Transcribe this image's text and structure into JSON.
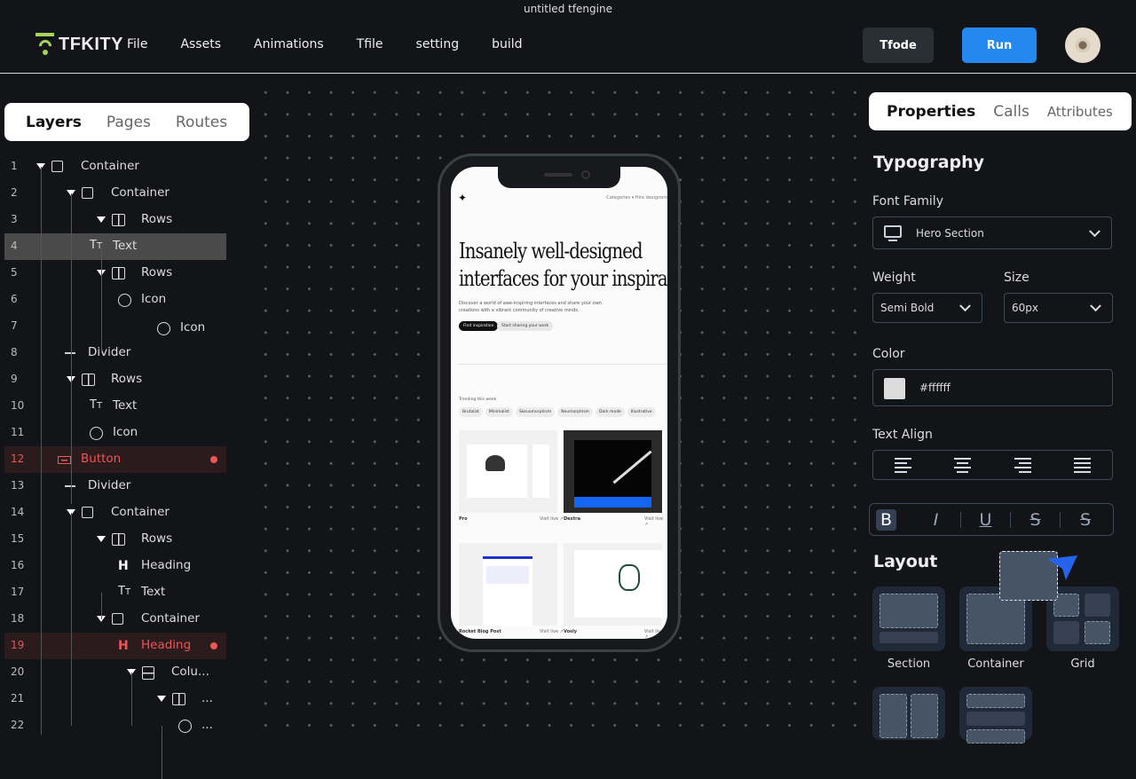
{
  "window_title": "untitled tfengine",
  "brand": {
    "name": "TFKITY",
    "color": "#a6d35d"
  },
  "menu": [
    "File",
    "Assets",
    "Animations",
    "Tfile",
    "setting",
    "build"
  ],
  "toolbar": {
    "tfode_label": "Tfode",
    "run_label": "Run",
    "run_color": "#2388f0"
  },
  "left_tabs": [
    {
      "label": "Layers",
      "active": true
    },
    {
      "label": "Pages"
    },
    {
      "label": "Routes"
    }
  ],
  "layers": [
    {
      "n": "1",
      "label": "Container",
      "icon": "square-icon",
      "arrow": true
    },
    {
      "n": "2",
      "label": "Container",
      "icon": "square-icon",
      "arrow": true
    },
    {
      "n": "3",
      "label": "Rows",
      "icon": "rows-icon",
      "arrow": true
    },
    {
      "n": "4",
      "label": "Text",
      "icon": "text-icon",
      "state": "selected"
    },
    {
      "n": "5",
      "label": "Rows",
      "icon": "rows-icon",
      "arrow": true
    },
    {
      "n": "6",
      "label": "Icon",
      "icon": "circle-icon"
    },
    {
      "n": "7",
      "label": "Icon",
      "icon": "circle-icon"
    },
    {
      "n": "8",
      "label": "Divider",
      "icon": "divider-icon"
    },
    {
      "n": "9",
      "label": "Rows",
      "icon": "rows-icon",
      "arrow": true
    },
    {
      "n": "10",
      "label": "Text",
      "icon": "text-icon"
    },
    {
      "n": "11",
      "label": "Icon",
      "icon": "circle-icon"
    },
    {
      "n": "12",
      "label": "Button",
      "icon": "button-icon",
      "state": "error"
    },
    {
      "n": "13",
      "label": "Divider",
      "icon": "divider-icon"
    },
    {
      "n": "14",
      "label": "Container",
      "icon": "square-icon",
      "arrow": true
    },
    {
      "n": "15",
      "label": "Rows",
      "icon": "rows-icon",
      "arrow": true
    },
    {
      "n": "16",
      "label": "Heading",
      "icon": "heading-icon"
    },
    {
      "n": "17",
      "label": "Text",
      "icon": "text-icon"
    },
    {
      "n": "18",
      "label": "Container",
      "icon": "square-icon",
      "arrow": true
    },
    {
      "n": "19",
      "label": "Heading",
      "icon": "heading-icon",
      "state": "error"
    },
    {
      "n": "20",
      "label": "Colu...",
      "icon": "columns-icon",
      "arrow": true
    },
    {
      "n": "21",
      "label": "...",
      "icon": "rows-icon",
      "arrow": true
    },
    {
      "n": "22",
      "label": "...",
      "icon": "circle-icon"
    }
  ],
  "preview": {
    "nav_links": "Categories ▾    Hire designers",
    "headline_1": "Insanely well-designed",
    "headline_2": "interfaces for your inspirati",
    "paragraph": "Discover a world of awe-inspiring interfaces and share your own creations with a vibrant community of creative minds.",
    "primary_cta": "Find inspiration",
    "secondary_cta": "Start sharing your work",
    "trending_label": "Trending this week",
    "chips": [
      "Brutalist",
      "Minimalist",
      "Skeuomorphism",
      "Neumorphism",
      "Dark mode",
      "Illustrative"
    ],
    "cards": [
      {
        "name": "Pro",
        "visit": "Visit live ↗"
      },
      {
        "name": "Dextra",
        "visit": "Visit live ↗"
      },
      {
        "name": "Rocket Blog Post",
        "visit": "Visit live ↗"
      },
      {
        "name": "Vosly",
        "visit": "Visit live ↗"
      }
    ]
  },
  "right_tabs": [
    {
      "label": "Properties",
      "active": true
    },
    {
      "label": "Calls"
    },
    {
      "label": "Attributes"
    }
  ],
  "typography": {
    "title": "Typography",
    "font_family_label": "Font Family",
    "font_family_value": "Hero Section",
    "weight_label": "Weight",
    "weight_value": "Semi Bold",
    "size_label": "Size",
    "size_value": "60px",
    "color_label": "Color",
    "color_value": "#ffffff",
    "text_align_label": "Text Align",
    "format_buttons": [
      "B",
      "I",
      "U",
      "S",
      "S"
    ]
  },
  "layout": {
    "title": "Layout",
    "items": [
      "Section",
      "Container",
      "Grid"
    ]
  }
}
